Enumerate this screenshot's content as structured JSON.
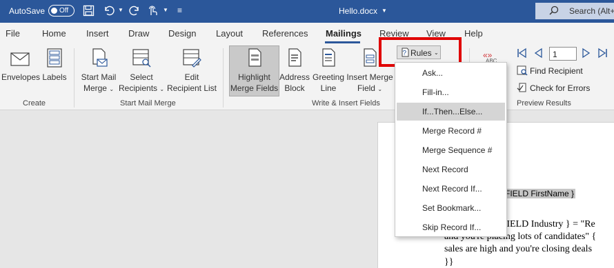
{
  "titlebar": {
    "autosave_label": "AutoSave",
    "toggle_state": "Off",
    "document_title": "Hello.docx",
    "search_placeholder": "Search (Alt+"
  },
  "tabs": [
    {
      "label": "File"
    },
    {
      "label": "Home"
    },
    {
      "label": "Insert"
    },
    {
      "label": "Draw"
    },
    {
      "label": "Design"
    },
    {
      "label": "Layout"
    },
    {
      "label": "References"
    },
    {
      "label": "Mailings",
      "active": true
    },
    {
      "label": "Review"
    },
    {
      "label": "View"
    },
    {
      "label": "Help"
    }
  ],
  "ribbon": {
    "create": {
      "envelopes": "Envelopes",
      "labels": "Labels",
      "group_label": "Create"
    },
    "start_mail_merge": {
      "start_line1": "Start Mail",
      "start_line2": "Merge",
      "select_line1": "Select",
      "select_line2": "Recipients",
      "edit_line1": "Edit",
      "edit_line2": "Recipient List",
      "group_label": "Start Mail Merge"
    },
    "write_insert": {
      "highlight_line1": "Highlight",
      "highlight_line2": "Merge Fields",
      "address_line1": "Address",
      "address_line2": "Block",
      "greeting_line1": "Greeting",
      "greeting_line2": "Line",
      "insert_line1": "Insert Merge",
      "insert_line2": "Field",
      "rules_label": "Rules",
      "group_label": "Write & Insert Fields"
    },
    "preview": {
      "abc_label": "ABC",
      "record_number": "1",
      "find_recipient": "Find Recipient",
      "check_errors": "Check for Errors",
      "group_label": "Preview Results"
    }
  },
  "rules_menu": {
    "items": [
      {
        "label": "Ask..."
      },
      {
        "label": "Fill-in..."
      },
      {
        "label": "If...Then...Else..."
      },
      {
        "label": "Merge Record #"
      },
      {
        "label": "Merge Sequence #"
      },
      {
        "label": "Next Record"
      },
      {
        "label": "Next Record If..."
      },
      {
        "label": "Set Bookmark..."
      },
      {
        "label": "Skip Record If..."
      }
    ]
  },
  "document": {
    "line1": "FIELD FirstName }",
    "line2": "EFIELD Industry } = \"Re",
    "line3": "and you're placing lots of candidates\" {",
    "line4": "sales are high and you're closing deals",
    "line5": "}}"
  },
  "colors": {
    "titlebar_bg": "#2b579a",
    "highlight_box": "#e00000",
    "menu_hover": "#d5d5d5"
  }
}
